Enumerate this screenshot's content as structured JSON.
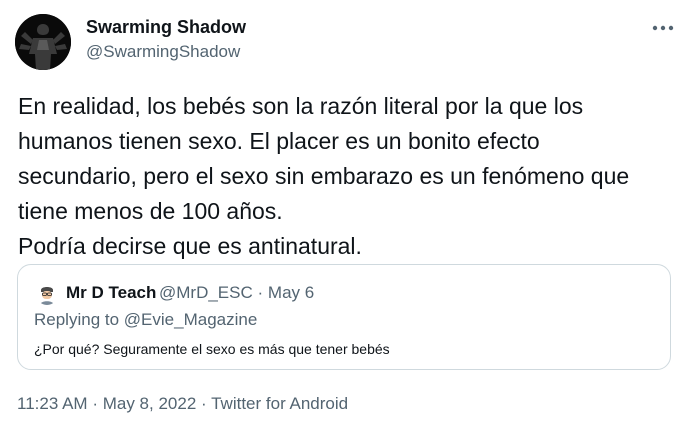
{
  "tweet": {
    "author_name": "Swarming Shadow",
    "author_handle": "@SwarmingShadow",
    "more_icon": "ellipsis-icon",
    "text_lines": [
      "En realidad, los bebés son la razón literal por la que los",
      "humanos tienen sexo. El placer es un bonito efecto",
      "secundario, pero el sexo sin embarazo es un fenómeno que",
      "tiene menos de 100 años.",
      "Podría decirse que es antinatural."
    ],
    "quote": {
      "author_name": "Mr D Teach",
      "author_handle": "@MrD_ESC",
      "separator": "·",
      "date": "May 6",
      "replying_prefix": "Replying to",
      "replying_to": "@Evie_Magazine",
      "text": "¿Por qué? Seguramente el sexo es más que tener bebés"
    },
    "footer": {
      "time": "11:23 AM",
      "separator": "·",
      "date": "May 8, 2022",
      "source": "Twitter for Android"
    }
  }
}
